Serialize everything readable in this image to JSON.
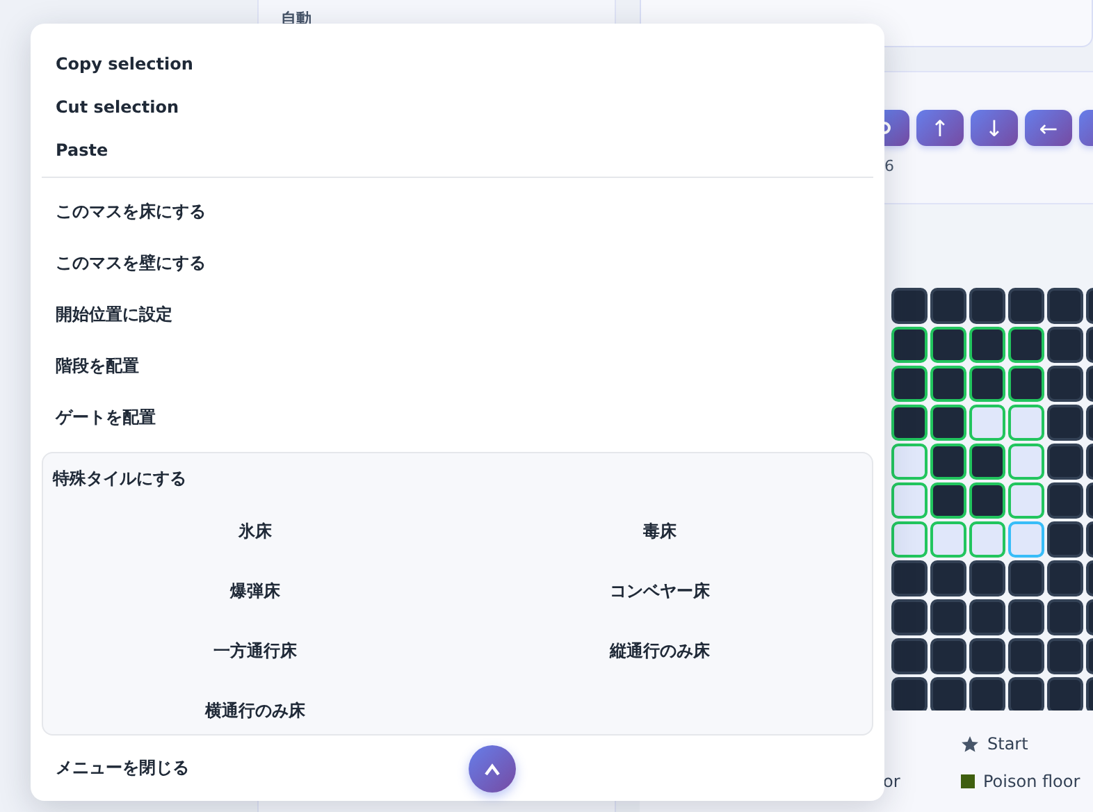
{
  "background": {
    "left_panel": {
      "label": "自動"
    },
    "toolbar": {
      "buttons": [
        {
          "kind": "redo"
        },
        {
          "kind": "text",
          "label": "↑"
        },
        {
          "kind": "text",
          "label": "↓"
        },
        {
          "kind": "text",
          "label": "←"
        },
        {
          "kind": "right"
        }
      ],
      "note": "6"
    },
    "grid": {
      "rows": [
        {
          "cells": [
            {
              "kind": "wall",
              "marked": false,
              "selected": false
            },
            {
              "kind": "wall",
              "marked": false,
              "selected": false
            },
            {
              "kind": "wall",
              "marked": false,
              "selected": false
            },
            {
              "kind": "wall",
              "marked": false,
              "selected": false
            },
            {
              "kind": "wall",
              "marked": false,
              "selected": false
            },
            {
              "kind": "wall",
              "marked": false,
              "selected": false
            }
          ]
        },
        {
          "cells": [
            {
              "kind": "wall",
              "marked": true,
              "selected": false
            },
            {
              "kind": "wall",
              "marked": true,
              "selected": false
            },
            {
              "kind": "wall",
              "marked": true,
              "selected": false
            },
            {
              "kind": "wall",
              "marked": true,
              "selected": false
            },
            {
              "kind": "wall",
              "marked": false,
              "selected": false
            },
            {
              "kind": "wall",
              "marked": false,
              "selected": false
            }
          ]
        },
        {
          "cells": [
            {
              "kind": "wall",
              "marked": true,
              "selected": false
            },
            {
              "kind": "wall",
              "marked": true,
              "selected": false
            },
            {
              "kind": "wall",
              "marked": true,
              "selected": false
            },
            {
              "kind": "wall",
              "marked": true,
              "selected": false
            },
            {
              "kind": "wall",
              "marked": false,
              "selected": false
            },
            {
              "kind": "wall",
              "marked": false,
              "selected": false
            }
          ]
        },
        {
          "cells": [
            {
              "kind": "wall",
              "marked": true,
              "selected": false
            },
            {
              "kind": "wall",
              "marked": true,
              "selected": false
            },
            {
              "kind": "floor",
              "marked": true,
              "selected": false
            },
            {
              "kind": "floor",
              "marked": true,
              "selected": false
            },
            {
              "kind": "wall",
              "marked": false,
              "selected": false
            },
            {
              "kind": "wall",
              "marked": false,
              "selected": false
            }
          ]
        },
        {
          "cells": [
            {
              "kind": "floor",
              "marked": true,
              "selected": false
            },
            {
              "kind": "wall",
              "marked": true,
              "selected": false
            },
            {
              "kind": "wall",
              "marked": true,
              "selected": false
            },
            {
              "kind": "floor",
              "marked": true,
              "selected": false
            },
            {
              "kind": "wall",
              "marked": false,
              "selected": false
            },
            {
              "kind": "wall",
              "marked": false,
              "selected": false
            }
          ]
        },
        {
          "cells": [
            {
              "kind": "floor",
              "marked": true,
              "selected": false
            },
            {
              "kind": "wall",
              "marked": true,
              "selected": false
            },
            {
              "kind": "wall",
              "marked": true,
              "selected": false
            },
            {
              "kind": "floor",
              "marked": true,
              "selected": false
            },
            {
              "kind": "wall",
              "marked": false,
              "selected": false
            },
            {
              "kind": "wall",
              "marked": false,
              "selected": false
            }
          ]
        },
        {
          "cells": [
            {
              "kind": "floor",
              "marked": true,
              "selected": false
            },
            {
              "kind": "floor",
              "marked": true,
              "selected": false
            },
            {
              "kind": "floor",
              "marked": true,
              "selected": false
            },
            {
              "kind": "floor",
              "marked": false,
              "selected": true
            },
            {
              "kind": "wall",
              "marked": false,
              "selected": false
            },
            {
              "kind": "wall",
              "marked": false,
              "selected": false
            }
          ]
        },
        {
          "cells": [
            {
              "kind": "wall",
              "marked": false,
              "selected": false
            },
            {
              "kind": "wall",
              "marked": false,
              "selected": false
            },
            {
              "kind": "wall",
              "marked": false,
              "selected": false
            },
            {
              "kind": "wall",
              "marked": false,
              "selected": false
            },
            {
              "kind": "wall",
              "marked": false,
              "selected": false
            },
            {
              "kind": "wall",
              "marked": false,
              "selected": false
            }
          ]
        },
        {
          "cells": [
            {
              "kind": "wall",
              "marked": false,
              "selected": false
            },
            {
              "kind": "wall",
              "marked": false,
              "selected": false
            },
            {
              "kind": "wall",
              "marked": false,
              "selected": false
            },
            {
              "kind": "wall",
              "marked": false,
              "selected": false
            },
            {
              "kind": "wall",
              "marked": false,
              "selected": false
            },
            {
              "kind": "wall",
              "marked": false,
              "selected": false
            }
          ]
        },
        {
          "cells": [
            {
              "kind": "wall",
              "marked": false,
              "selected": false
            },
            {
              "kind": "wall",
              "marked": false,
              "selected": false
            },
            {
              "kind": "wall",
              "marked": false,
              "selected": false
            },
            {
              "kind": "wall",
              "marked": false,
              "selected": false
            },
            {
              "kind": "wall",
              "marked": false,
              "selected": false
            },
            {
              "kind": "wall",
              "marked": false,
              "selected": false
            }
          ]
        },
        {
          "cells": [
            {
              "kind": "wall",
              "marked": false,
              "selected": false
            },
            {
              "kind": "wall",
              "marked": false,
              "selected": false
            },
            {
              "kind": "wall",
              "marked": false,
              "selected": false
            },
            {
              "kind": "wall",
              "marked": false,
              "selected": false
            },
            {
              "kind": "wall",
              "marked": false,
              "selected": false
            },
            {
              "kind": "wall",
              "marked": false,
              "selected": false
            }
          ]
        }
      ]
    },
    "legend": [
      {
        "kind": "star",
        "label": "Start"
      },
      {
        "kind": "text",
        "label": "or"
      },
      {
        "kind": "swatch",
        "label": "Poison floor",
        "color": "#3f5f0f"
      }
    ]
  },
  "context_menu": {
    "clipboard_items": [
      "Copy selection",
      "Cut selection",
      "Paste"
    ],
    "tile_items": [
      "このマスを床にする",
      "このマスを壁にする",
      "開始位置に設定",
      "階段を配置",
      "ゲートを配置"
    ],
    "special_tiles": {
      "title": "特殊タイルにする",
      "options": [
        "氷床",
        "毒床",
        "爆弾床",
        "コンベヤー床",
        "一方通行床",
        "縦通行のみ床",
        "横通行のみ床"
      ]
    },
    "close_label": "メニューを閉じる"
  },
  "scroll_button": {
    "kind": "up"
  }
}
